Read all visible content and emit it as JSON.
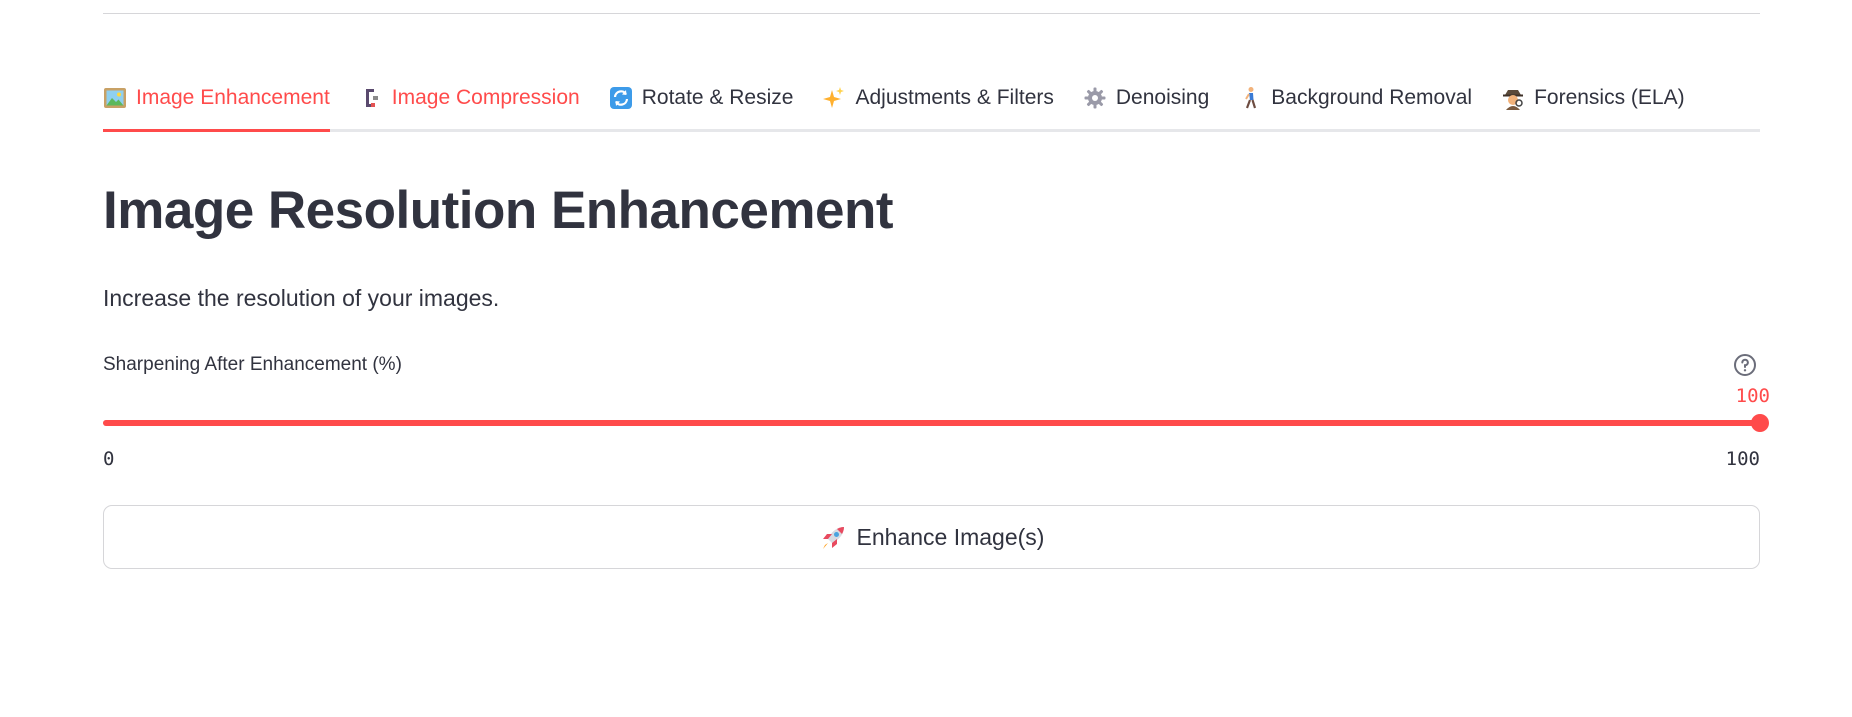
{
  "tabs": [
    {
      "label": "Image Enhancement",
      "icon": "framed-picture-icon",
      "state": "active"
    },
    {
      "label": "Image Compression",
      "icon": "clamp-icon",
      "state": "highlighted"
    },
    {
      "label": "Rotate & Resize",
      "icon": "arrows-rotate-icon",
      "state": "normal"
    },
    {
      "label": "Adjustments & Filters",
      "icon": "sparkles-icon",
      "state": "normal"
    },
    {
      "label": "Denoising",
      "icon": "gear-icon",
      "state": "normal"
    },
    {
      "label": "Background Removal",
      "icon": "walking-person-icon",
      "state": "normal"
    },
    {
      "label": "Forensics (ELA)",
      "icon": "detective-icon",
      "state": "normal"
    }
  ],
  "main": {
    "title": "Image Resolution Enhancement",
    "subtitle": "Increase the resolution of your images."
  },
  "slider": {
    "label": "Sharpening After Enhancement (%)",
    "value": "100",
    "min": "0",
    "max": "100",
    "help_icon": "question-circle-icon"
  },
  "enhance_button": {
    "label": "Enhance Image(s)",
    "icon": "rocket-icon"
  },
  "colors": {
    "accent": "#ff4b4b",
    "text": "#31333f",
    "border": "#d6d6d9"
  }
}
